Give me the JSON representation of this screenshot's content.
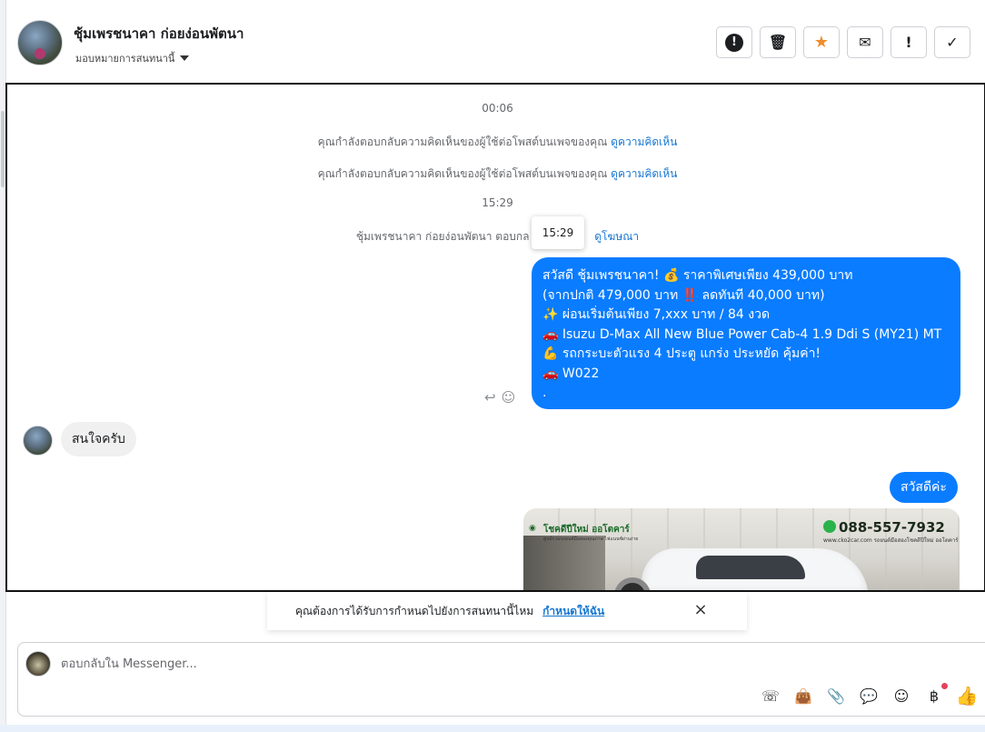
{
  "header": {
    "contact_name": "ชุ้มเพรชนาคา ก่อยง่อนพัตนา",
    "assign_label": "มอบหมายการสนทนานี้",
    "toolbar": [
      {
        "name": "alert-button",
        "glyph": "!"
      },
      {
        "name": "delete-button",
        "glyph": "🗑"
      },
      {
        "name": "star-button",
        "glyph": "★"
      },
      {
        "name": "mark-unread-button",
        "glyph": "✉"
      },
      {
        "name": "follow-up-button",
        "glyph": "!"
      },
      {
        "name": "done-button",
        "glyph": "✓"
      }
    ]
  },
  "conversation": {
    "time_1": "00:06",
    "system_1": "คุณกำลังตอบกลับความคิดเห็นของผู้ใช้ต่อโพสต์บนเพจของคุณ",
    "system_1_link": "ดูความคิดเห็น",
    "system_2": "คุณกำลังตอบกลับความคิดเห็นของผู้ใช้ต่อโพสต์บนเพจของคุณ",
    "system_2_link": "ดูความคิดเห็น",
    "time_2": "15:29",
    "system_3": "ชุ้มเพรชนาคา ก่อยง่อนพัตนา ตอบกล",
    "system_3_link": "ดูโฆษณา",
    "tooltip_time": "15:29",
    "ad_message_lines": [
      "สวัสดี ชุ้มเพรชนาคา! 💰 ราคาพิเศษเพียง 439,000 บาท",
      "(จากปกติ 479,000 บาท ‼️ ลดทันที 40,000 บาท)",
      "✨ ผ่อนเริ่มต้นเพียง 7,xxx บาท / 84 งวด",
      "🚗 Isuzu D-Max All New Blue Power Cab-4 1.9 Ddi S (MY21) MT",
      "💪 รถกระบะตัวแรง 4 ประตู แกร่ง ประหยัด คุ้มค่า!",
      "🚗 W022",
      "."
    ],
    "incoming_message": "สนใจครับ",
    "outgoing_greeting": "สวัสดีค่ะ",
    "image": {
      "brand": "โชคดีปีใหม่ ออโตคาร์",
      "brand_sub": "ศูนย์รวมรถยนต์มือสองคุณภาพ ไฟแนนซ์ผ่านง่าย",
      "phone": "088-557-7932",
      "site": "www.cko2car.com  รถยนต์มือสองโชคดีปีใหม่ ออโตคาร์"
    }
  },
  "banner": {
    "text": "คุณต้องการได้รับการกำหนดไปยังการสนทนานี้ไหม",
    "link": "กำหนดให้ฉัน",
    "close": "×"
  },
  "composer": {
    "placeholder": "ตอบกลับใน Messenger...",
    "tools": [
      {
        "name": "call-icon",
        "glyph": "☏"
      },
      {
        "name": "shop-bag-icon",
        "glyph": "👜"
      },
      {
        "name": "attach-icon",
        "glyph": "📎"
      },
      {
        "name": "saved-replies-icon",
        "glyph": "💬"
      },
      {
        "name": "emoji-icon",
        "glyph": "☺"
      },
      {
        "name": "payment-icon",
        "glyph": "฿"
      },
      {
        "name": "like-icon",
        "glyph": "👍"
      }
    ]
  }
}
